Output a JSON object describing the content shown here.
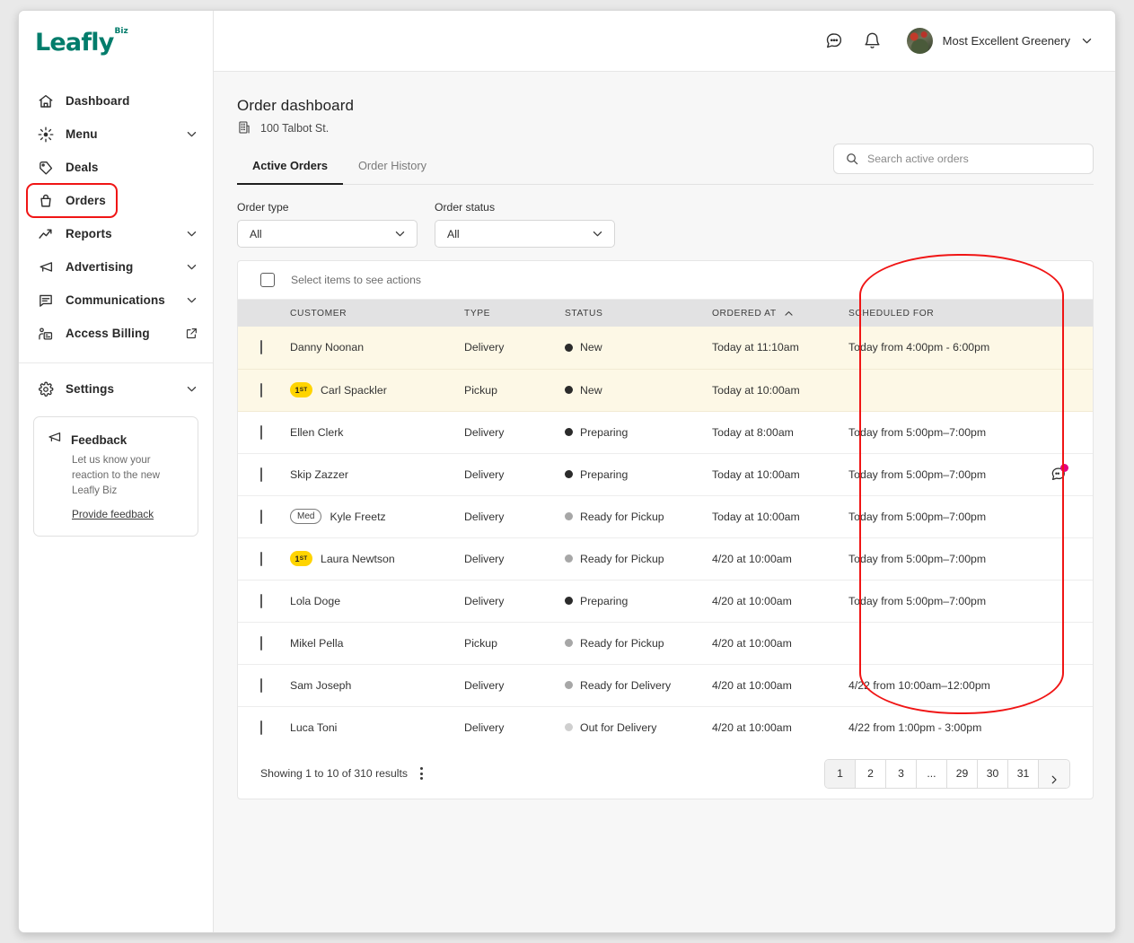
{
  "brand": {
    "name": "Leafly",
    "suffix": "Biz",
    "color": "#017c6b"
  },
  "sidebar": {
    "items": [
      {
        "label": "Dashboard",
        "icon": "home-icon",
        "chevron": false
      },
      {
        "label": "Menu",
        "icon": "menu-sparkle-icon",
        "chevron": true
      },
      {
        "label": "Deals",
        "icon": "tag-icon",
        "chevron": false
      },
      {
        "label": "Orders",
        "icon": "bag-icon",
        "chevron": false,
        "highlighted": true
      },
      {
        "label": "Reports",
        "icon": "trending-up-icon",
        "chevron": true
      },
      {
        "label": "Advertising",
        "icon": "megaphone-icon",
        "chevron": true
      },
      {
        "label": "Communications",
        "icon": "chat-square-icon",
        "chevron": true
      },
      {
        "label": "Access Billing",
        "icon": "billing-person-icon",
        "external": true
      }
    ],
    "settings": {
      "label": "Settings",
      "icon": "gear-icon",
      "chevron": true
    },
    "feedback": {
      "title": "Feedback",
      "body": "Let us know your reaction to the new Leafly Biz",
      "link": "Provide feedback"
    }
  },
  "topbar": {
    "messages_icon": "chat-bubble-icon",
    "notifications_icon": "bell-icon",
    "account_name": "Most Excellent Greenery",
    "chevron_icon": "chevron-down-icon"
  },
  "page": {
    "title": "Order dashboard",
    "location_icon": "building-icon",
    "location": "100 Talbot St."
  },
  "tabs": [
    {
      "label": "Active Orders",
      "active": true
    },
    {
      "label": "Order History",
      "active": false
    }
  ],
  "search": {
    "placeholder": "Search active orders",
    "value": "",
    "icon": "search-icon"
  },
  "filters": [
    {
      "label": "Order type",
      "value": "All"
    },
    {
      "label": "Order status",
      "value": "All"
    }
  ],
  "bulk": {
    "label": "Select items to see actions"
  },
  "table": {
    "columns": [
      "CUSTOMER",
      "TYPE",
      "STATUS",
      "ORDERED AT",
      "SCHEDULED FOR"
    ],
    "sorted_column": "ORDERED AT",
    "sort_direction": "asc",
    "rows": [
      {
        "customer": "Danny Noonan",
        "badge": "",
        "type": "Delivery",
        "status": "New",
        "status_tone": "dark",
        "ordered_at": "Today at 11:10am",
        "scheduled_for": "Today from 4:00pm - 6:00pm",
        "highlight": true,
        "chat": false
      },
      {
        "customer": "Carl Spackler",
        "badge": "1st",
        "badge_kind": "first",
        "type": "Pickup",
        "status": "New",
        "status_tone": "dark",
        "ordered_at": "Today at 10:00am",
        "scheduled_for": "",
        "highlight": true,
        "chat": false
      },
      {
        "customer": "Ellen Clerk",
        "badge": "",
        "type": "Delivery",
        "status": "Preparing",
        "status_tone": "dark",
        "ordered_at": "Today at 8:00am",
        "scheduled_for": "Today from 5:00pm–7:00pm",
        "highlight": false,
        "chat": false
      },
      {
        "customer": "Skip Zazzer",
        "badge": "",
        "type": "Delivery",
        "status": "Preparing",
        "status_tone": "dark",
        "ordered_at": "Today at 10:00am",
        "scheduled_for": "Today from 5:00pm–7:00pm",
        "highlight": false,
        "chat": true
      },
      {
        "customer": "Kyle Freetz",
        "badge": "Med",
        "badge_kind": "med",
        "type": "Delivery",
        "status": "Ready for Pickup",
        "status_tone": "gray",
        "ordered_at": "Today at 10:00am",
        "scheduled_for": "Today from 5:00pm–7:00pm",
        "highlight": false,
        "chat": false
      },
      {
        "customer": "Laura Newtson",
        "badge": "1st",
        "badge_kind": "first",
        "type": "Delivery",
        "status": "Ready for Pickup",
        "status_tone": "gray",
        "ordered_at": "4/20 at 10:00am",
        "scheduled_for": "Today from 5:00pm–7:00pm",
        "highlight": false,
        "chat": false
      },
      {
        "customer": "Lola Doge",
        "badge": "",
        "type": "Delivery",
        "status": "Preparing",
        "status_tone": "dark",
        "ordered_at": "4/20 at 10:00am",
        "scheduled_for": "Today from 5:00pm–7:00pm",
        "highlight": false,
        "chat": false
      },
      {
        "customer": "Mikel Pella",
        "badge": "",
        "type": "Pickup",
        "status": "Ready for Pickup",
        "status_tone": "gray",
        "ordered_at": "4/20 at 10:00am",
        "scheduled_for": "",
        "highlight": false,
        "chat": false
      },
      {
        "customer": "Sam Joseph",
        "badge": "",
        "type": "Delivery",
        "status": "Ready for Delivery",
        "status_tone": "gray",
        "ordered_at": "4/20 at 10:00am",
        "scheduled_for": "4/22 from 10:00am–12:00pm",
        "highlight": false,
        "chat": false
      },
      {
        "customer": "Luca Toni",
        "badge": "",
        "type": "Delivery",
        "status": "Out for Delivery",
        "status_tone": "light",
        "ordered_at": "4/20 at 10:00am",
        "scheduled_for": "4/22 from 1:00pm - 3:00pm",
        "highlight": false,
        "chat": false
      }
    ]
  },
  "footer": {
    "showing_prefix": "Showing ",
    "showing_range": "1 to 10",
    "showing_mid": " of ",
    "showing_total": "310",
    "showing_suffix": " results",
    "showing_full": "Showing 1 to 10 of 310 results",
    "pages": [
      "1",
      "2",
      "3",
      "...",
      "29",
      "30",
      "31"
    ],
    "active_page": "1",
    "next_icon": "chevron-right-icon"
  },
  "annotations": {
    "color": "#f01515",
    "orders_nav_box": true,
    "scheduled_for_oval": true
  },
  "status_colors": {
    "dark": "#2b2b2b",
    "gray": "#a7a7a7",
    "light": "#cfcfcf"
  }
}
